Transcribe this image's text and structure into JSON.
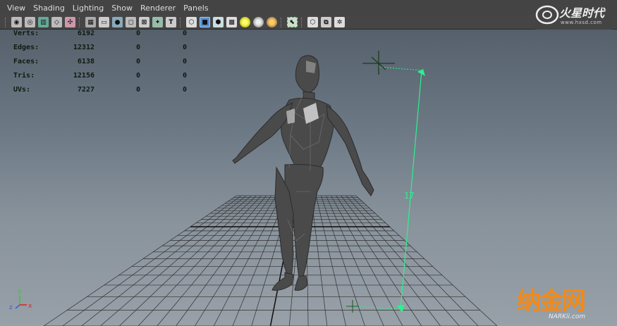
{
  "menu": [
    "View",
    "Shading",
    "Lighting",
    "Show",
    "Renderer",
    "Panels"
  ],
  "logo": {
    "main": "火星时代",
    "sub": "www.hxsd.com"
  },
  "hud": {
    "rows": [
      {
        "label": "Verts:",
        "values": [
          "6192",
          "0",
          "0"
        ]
      },
      {
        "label": "Edges:",
        "values": [
          "12312",
          "0",
          "0"
        ]
      },
      {
        "label": "Faces:",
        "values": [
          "6138",
          "0",
          "0"
        ]
      },
      {
        "label": "Tris:",
        "values": [
          "12156",
          "0",
          "0"
        ]
      },
      {
        "label": "UVs:",
        "values": [
          "7227",
          "0",
          "0"
        ]
      }
    ]
  },
  "measure": {
    "distance": "17"
  },
  "axis": {
    "x": "x",
    "y": "y",
    "z": "z"
  },
  "watermark": {
    "main": "纳金网",
    "sub": "NARKii.com"
  },
  "colors": {
    "measure_line": "#2bf28f",
    "grid": "#303030",
    "model": "#4a4a4a",
    "watermark": "#f28a17"
  }
}
